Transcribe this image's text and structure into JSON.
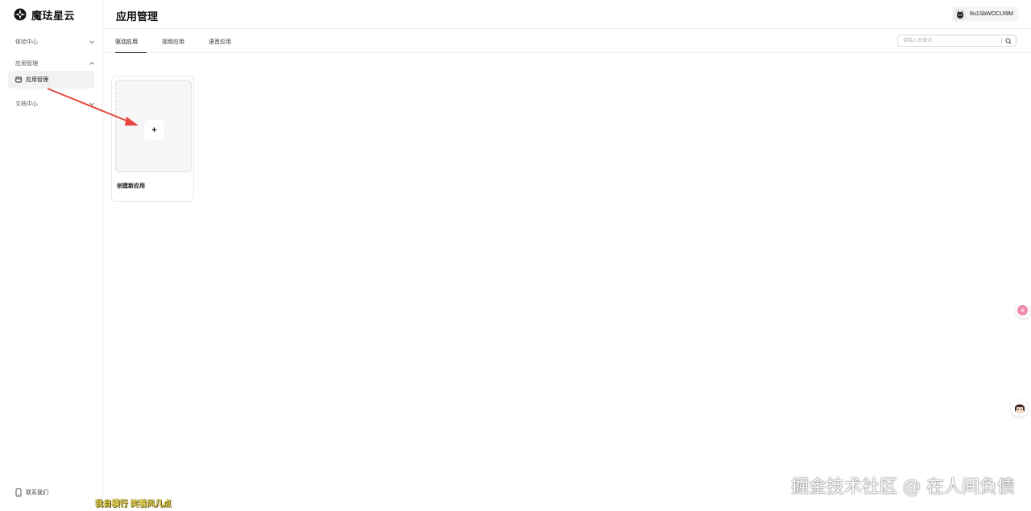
{
  "brand": {
    "name": "魔珐星云",
    "logo_icon": "compass-logo-icon"
  },
  "sidebar": {
    "groups": [
      {
        "label": "体验中心",
        "expanded": false
      },
      {
        "label": "应用管理",
        "expanded": true,
        "items": [
          {
            "label": "应用管理",
            "icon": "app-box-icon",
            "active": true
          }
        ]
      },
      {
        "label": "文档中心",
        "expanded": false
      }
    ],
    "contact_label": "联系我们"
  },
  "header": {
    "title": "应用管理",
    "user_name": "9u1SbWOCUI9M"
  },
  "tabs": [
    {
      "label": "驱动应用",
      "active": true
    },
    {
      "label": "视频应用",
      "active": false
    },
    {
      "label": "语音应用",
      "active": false
    }
  ],
  "search": {
    "placeholder": "请输入关键词",
    "value": ""
  },
  "cards": [
    {
      "label": "创建新应用",
      "plus": "+"
    }
  ],
  "float_widgets": {
    "pink_icon": "flower-icon",
    "pink_glyph": "※"
  },
  "overlay": {
    "caption": "我自横行 笑看风几点",
    "watermark": "掘金技术社区 @ 在人间负债"
  },
  "colors": {
    "arrow": "#e8473f",
    "accent": "#111111"
  }
}
